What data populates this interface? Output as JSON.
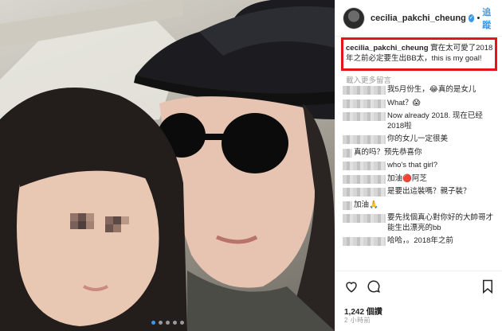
{
  "post": {
    "username": "cecilia_pakchi_cheung",
    "verified_mark": "✓",
    "separator": "•",
    "follow_label": "追蹤",
    "caption_user": "cecilia_pakchi_cheung",
    "caption_text": " 實在太可愛了2018年之前必定要生出BB太，this is my goal!",
    "load_more": "載入更多留言",
    "likes": "1,242 個讚",
    "time_ago": "2 小時前"
  },
  "comments": [
    {
      "indent": "wide",
      "text": "我5月份生，😂真的是女儿"
    },
    {
      "indent": "wide",
      "text": "                   What？😱"
    },
    {
      "indent": "wide",
      "text": "    Now already 2018. 现在已经2018啦"
    },
    {
      "indent": "wide",
      "text": "你的女儿一定很美"
    },
    {
      "indent": "narrow",
      "text": "         真的吗？预先恭喜你"
    },
    {
      "indent": "wide",
      "text": "               who's that girl?"
    },
    {
      "indent": "wide",
      "text": "          加油🔴阿芝"
    },
    {
      "indent": "wide",
      "text": "是要出這裝嗎？親子裝？"
    },
    {
      "indent": "narrow",
      "text": "    加油🙏"
    },
    {
      "indent": "wide",
      "text": "要先找個真心對你好的大帥哥才能生出漂亮的bb"
    },
    {
      "indent": "wide",
      "text": "哈哈，。2018年之前"
    }
  ],
  "icons": {
    "like": "heart-icon",
    "comment": "comment-icon",
    "share": "share-icon",
    "save": "bookmark-icon"
  },
  "carousel": {
    "count": 5,
    "active_index": 0
  }
}
